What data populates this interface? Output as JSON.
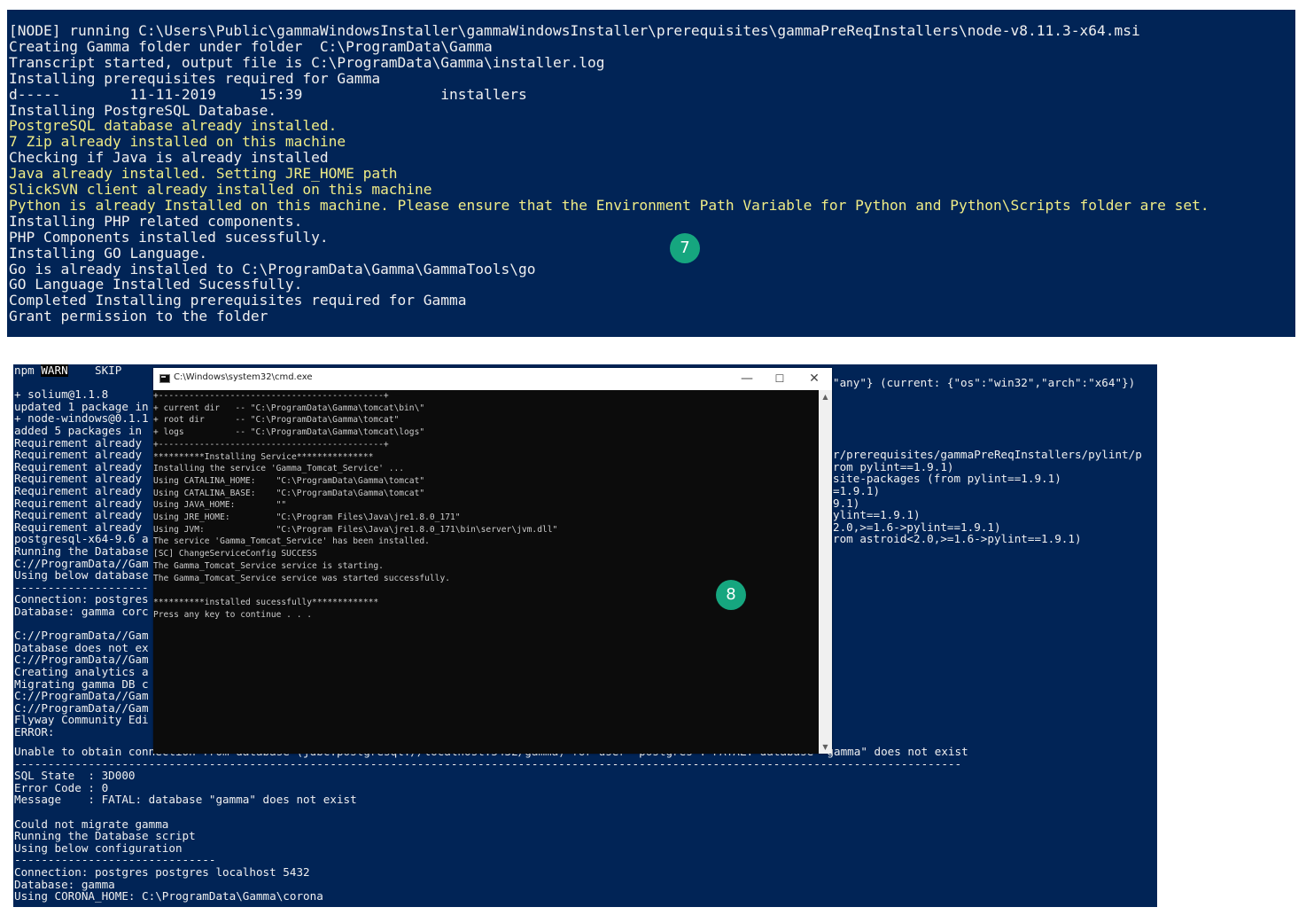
{
  "top_console": {
    "lines": [
      {
        "text": "[NODE] running C:\\Users\\Public\\gammaWindowsInstaller\\gammaWindowsInstaller\\prerequisites\\gammaPreReqInstallers\\node-v8.11.3-x64.msi",
        "highlight": false
      },
      {
        "text": "Creating Gamma folder under folder  C:\\ProgramData\\Gamma",
        "highlight": false
      },
      {
        "text": "Transcript started, output file is C:\\ProgramData\\Gamma\\installer.log",
        "highlight": false
      },
      {
        "text": "Installing prerequisites required for Gamma",
        "highlight": false
      },
      {
        "text": "d-----        11-11-2019     15:39                installers",
        "highlight": false
      },
      {
        "text": "Installing PostgreSQL Database.",
        "highlight": false
      },
      {
        "text": "PostgreSQL database already installed.",
        "highlight": true
      },
      {
        "text": "7 Zip already installed on this machine",
        "highlight": true
      },
      {
        "text": "Checking if Java is already installed",
        "highlight": false
      },
      {
        "text": "Java already installed. Setting JRE_HOME path",
        "highlight": true
      },
      {
        "text": "SlickSVN client already installed on this machine",
        "highlight": true
      },
      {
        "text": "Python is already Installed on this machine. Please ensure that the Environment Path Variable for Python and Python\\Scripts folder are set.",
        "highlight": true
      },
      {
        "text": "Installing PHP related components.",
        "highlight": false
      },
      {
        "text": "PHP Components installed sucessfully.",
        "highlight": false
      },
      {
        "text": "Installing GO Language.",
        "highlight": false
      },
      {
        "text": "Go is already installed to C:\\ProgramData\\Gamma\\GammaTools\\go",
        "highlight": false
      },
      {
        "text": "GO Language Installed Sucessfully.",
        "highlight": false
      },
      {
        "text": "Completed Installing prerequisites required for Gamma",
        "highlight": false
      },
      {
        "text": "Grant permission to the folder",
        "highlight": false
      }
    ]
  },
  "badges": [
    "7",
    "8"
  ],
  "bottom_console": {
    "npm_label": "npm",
    "warn_label": "WARN",
    "lines_left": [
      "npm WARN    SKIP",
      "",
      "+ solium@1.1.8",
      "updated 1 package in",
      "+ node-windows@0.1.1",
      "added 5 packages in",
      "Requirement already",
      "Requirement already",
      "Requirement already",
      "Requirement already",
      "Requirement already",
      "Requirement already",
      "Requirement already",
      "Requirement already",
      "postgresql-x64-9.6 a",
      "Running the Database",
      "C://ProgramData//Gam",
      "Using below database",
      "--------------------",
      "Connection: postgres",
      "Database: gamma corc",
      "",
      "C://ProgramData//Gam",
      "Database does not ex",
      "C://ProgramData//Gam",
      "Creating analytics a",
      "Migrating gamma DB c",
      "C://ProgramData//Gam",
      "C://ProgramData//Gam",
      "Flyway Community Edi",
      "ERROR:"
    ],
    "lines_right": [
      {
        "row": 1,
        "text": "\"any\"} (current: {\"os\":\"win32\",\"arch\":\"x64\"})"
      },
      {
        "row": 7,
        "text": "r/prerequisites/gammaPreReqInstallers/pylint/p"
      },
      {
        "row": 8,
        "text": "rom pylint==1.9.1)"
      },
      {
        "row": 9,
        "text": "site-packages (from pylint==1.9.1)"
      },
      {
        "row": 10,
        "text": "=1.9.1)"
      },
      {
        "row": 11,
        "text": "9.1)"
      },
      {
        "row": 12,
        "text": "ylint==1.9.1)"
      },
      {
        "row": 13,
        "text": "2.0,>=1.6->pylint==1.9.1)"
      },
      {
        "row": 14,
        "text": "rom astroid<2.0,>=1.6->pylint==1.9.1)"
      }
    ],
    "lines_bottom": [
      "Unable to obtain connection from database (jdbc:postgresql://localhost:5432/gamma) for user 'postgres': FATAL: database \"gamma\" does not exist",
      "---------------------------------------------------------------------------------------------------------------------------------------------",
      "SQL State  : 3D000",
      "Error Code : 0",
      "Message    : FATAL: database \"gamma\" does not exist",
      "",
      "Could not migrate gamma",
      "Running the Database script",
      "Using below configuration",
      "------------------------------",
      "Connection: postgres postgres localhost 5432",
      "Database: gamma",
      "Using CORONA_HOME: C:\\ProgramData\\Gamma\\corona"
    ]
  },
  "cmd_window": {
    "title": "C:\\Windows\\system32\\cmd.exe",
    "lines": [
      "+--------------------------------------------+",
      "+ current dir   -- \"C:\\ProgramData\\Gamma\\tomcat\\bin\\\"",
      "+ root dir      -- \"C:\\ProgramData\\Gamma\\tomcat\"",
      "+ logs          -- \"C:\\ProgramData\\Gamma\\tomcat\\logs\"",
      "+--------------------------------------------+",
      "**********Installing Service***************",
      "Installing the service 'Gamma_Tomcat_Service' ...",
      "Using CATALINA_HOME:    \"C:\\ProgramData\\Gamma\\tomcat\"",
      "Using CATALINA_BASE:    \"C:\\ProgramData\\Gamma\\tomcat\"",
      "Using JAVA_HOME:        \"\"",
      "Using JRE_HOME:         \"C:\\Program Files\\Java\\jre1.8.0_171\"",
      "Using JVM:              \"C:\\Program Files\\Java\\jre1.8.0_171\\bin\\server\\jvm.dll\"",
      "The service 'Gamma_Tomcat_Service' has been installed.",
      "[SC] ChangeServiceConfig SUCCESS",
      "The Gamma_Tomcat_Service service is starting.",
      "The Gamma_Tomcat_Service service was started successfully.",
      "",
      "**********installed sucessfully*************",
      "Press any key to continue . . ."
    ]
  },
  "colors": {
    "console_bg": "#012456",
    "console_text": "#f0f0f0",
    "console_highlight": "#f0ec86",
    "cmd_bg": "#0c0c0c",
    "cmd_text": "#cccccc",
    "badge": "#16a67f"
  },
  "icons": [
    "cmd-app-icon",
    "minimize-icon",
    "maximize-icon",
    "close-icon",
    "scroll-up-arrow-icon",
    "scroll-down-arrow-icon"
  ]
}
